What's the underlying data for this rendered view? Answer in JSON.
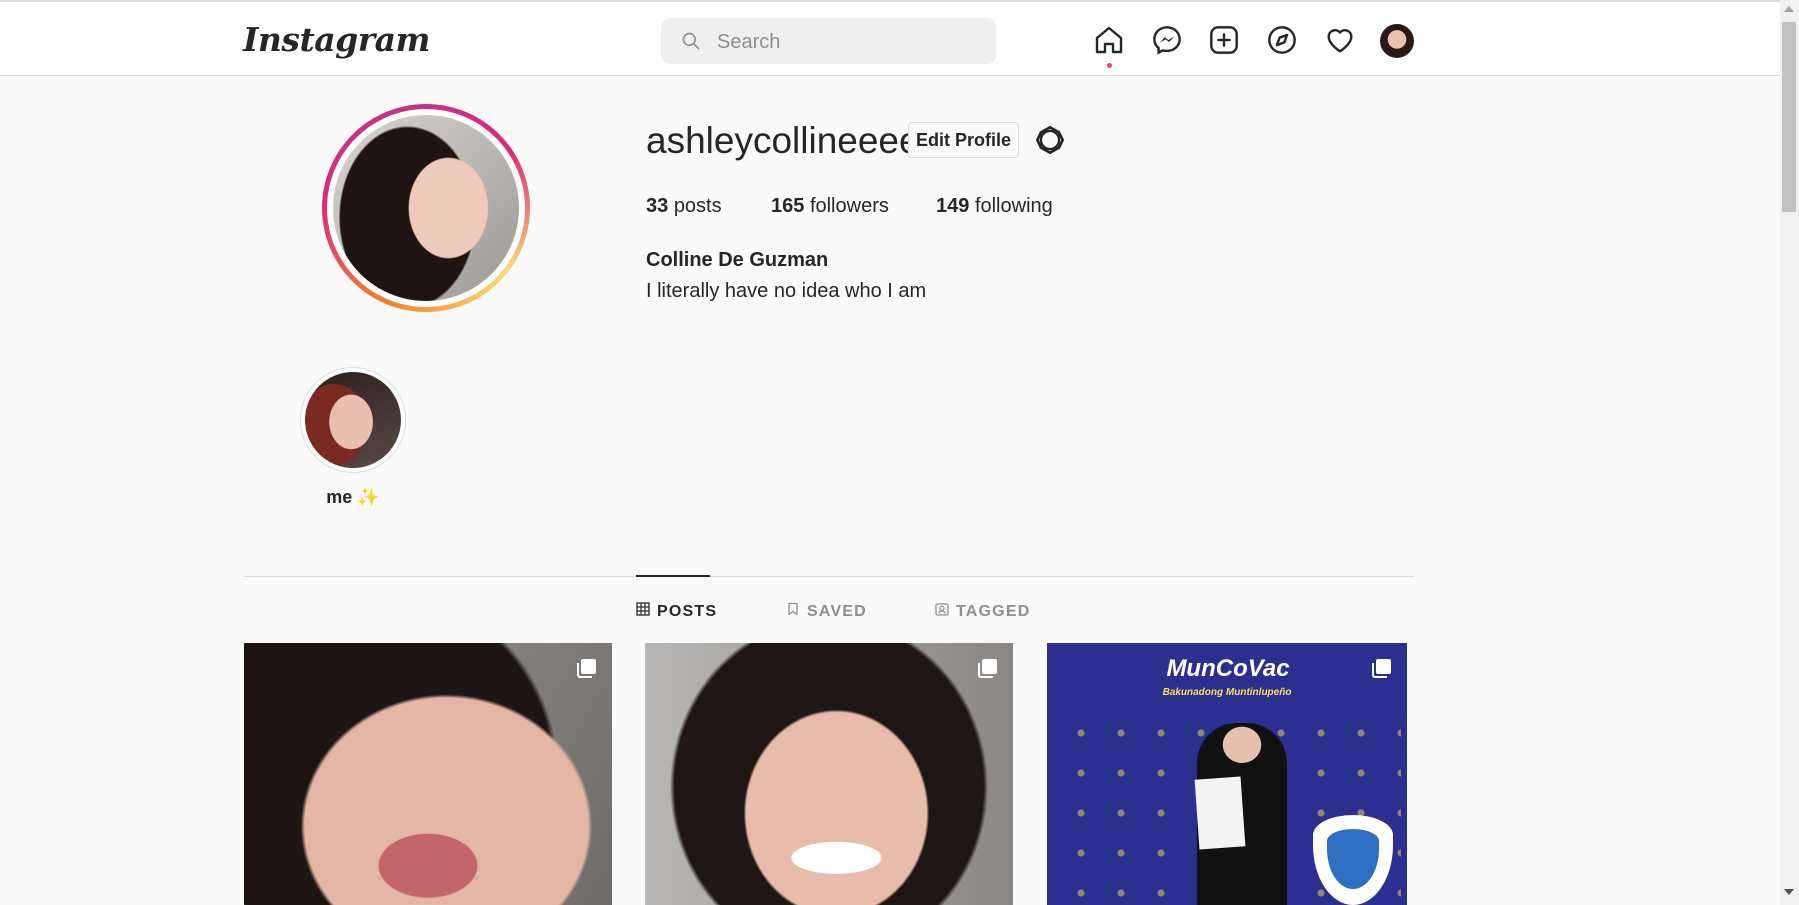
{
  "header": {
    "logo": "Instagram",
    "search": {
      "placeholder": "Search",
      "value": ""
    },
    "nav": [
      "home-icon",
      "messenger-icon",
      "new-post-icon",
      "explore-icon",
      "activity-icon",
      "profile-avatar"
    ]
  },
  "profile": {
    "username": "ashleycollineeee",
    "edit_label": "Edit Profile",
    "stats": {
      "posts_count": "33",
      "posts_label": "posts",
      "followers_count": "165",
      "followers_label": "followers",
      "following_count": "149",
      "following_label": "following"
    },
    "full_name": "Colline De Guzman",
    "bio": "I literally have no idea who I am"
  },
  "highlights": [
    {
      "label": "me ✨"
    }
  ],
  "tabs": [
    {
      "label": "POSTS",
      "active": true,
      "icon": "grid-icon"
    },
    {
      "label": "SAVED",
      "active": false,
      "icon": "bookmark-icon"
    },
    {
      "label": "TAGGED",
      "active": false,
      "icon": "tagged-icon"
    }
  ],
  "posts": [
    {
      "type": "carousel",
      "icon": "multiple-photos-icon"
    },
    {
      "type": "carousel",
      "icon": "multiple-photos-icon"
    },
    {
      "type": "carousel",
      "icon": "multiple-photos-icon",
      "banner_text": "MunCoVac",
      "banner_sub": "Bakunadong Muntinlupeño"
    }
  ],
  "colors": {
    "accent": "#ed4956",
    "text": "#262626",
    "muted": "#8e8e8e",
    "border": "#dbdbdb"
  }
}
